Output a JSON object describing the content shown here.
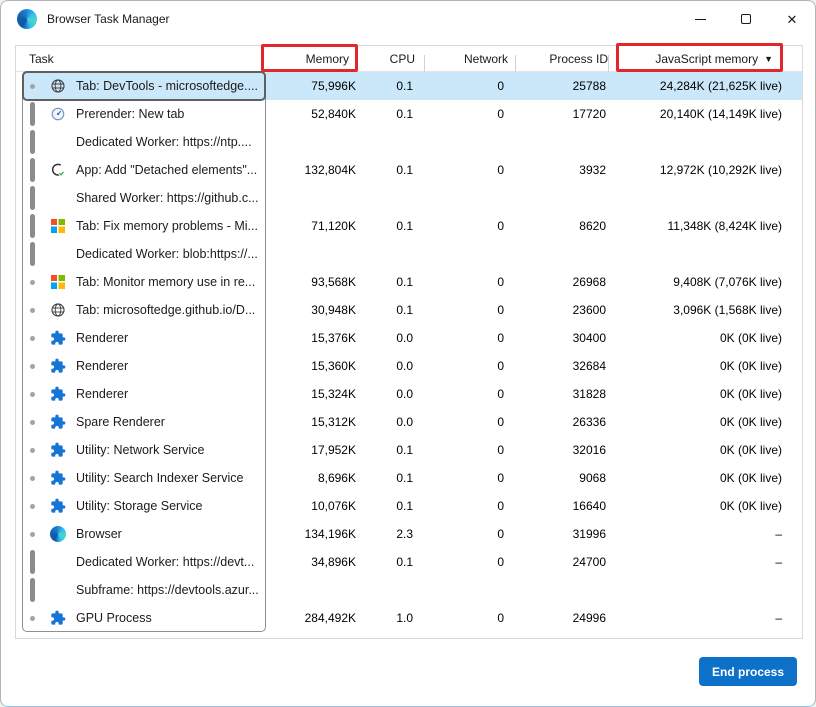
{
  "window": {
    "title": "Browser Task Manager",
    "app_icon": "edge-logo",
    "controls": {
      "minimize": "minimize",
      "maximize": "maximize",
      "close": "close"
    }
  },
  "table": {
    "headers": {
      "task": "Task",
      "memory": "Memory",
      "cpu": "CPU",
      "network": "Network",
      "process_id": "Process ID",
      "js_memory": "JavaScript memory",
      "sort_indicator": "▼",
      "sorted_column": "js_memory"
    },
    "rows": [
      {
        "task": "Tab: DevTools - microsoftedge....",
        "icon": "globe",
        "indicator": "dot",
        "memory": "75,996K",
        "cpu": "0.1",
        "network": "0",
        "pid": "25788",
        "js": "24,284K (21,625K live)",
        "selected": true
      },
      {
        "task": "Prerender: New tab",
        "icon": "newtab",
        "indicator": "bar",
        "memory": "52,840K",
        "cpu": "0.1",
        "network": "0",
        "pid": "17720",
        "js": "20,140K (14,149K live)"
      },
      {
        "task": "Dedicated Worker: https://ntp....",
        "icon": null,
        "indicator": "bar",
        "memory": "",
        "cpu": "",
        "network": "",
        "pid": "",
        "js": ""
      },
      {
        "task": "App: Add \"Detached elements\"...",
        "icon": "app",
        "indicator": "bar",
        "memory": "132,804K",
        "cpu": "0.1",
        "network": "0",
        "pid": "3932",
        "js": "12,972K (10,292K live)"
      },
      {
        "task": "Shared Worker: https://github.c...",
        "icon": null,
        "indicator": "bar",
        "memory": "",
        "cpu": "",
        "network": "",
        "pid": "",
        "js": ""
      },
      {
        "task": "Tab: Fix memory problems - Mi...",
        "icon": "microsoft",
        "indicator": "bar",
        "memory": "71,120K",
        "cpu": "0.1",
        "network": "0",
        "pid": "8620",
        "js": "11,348K (8,424K live)"
      },
      {
        "task": "Dedicated Worker: blob:https://...",
        "icon": null,
        "indicator": "bar",
        "memory": "",
        "cpu": "",
        "network": "",
        "pid": "",
        "js": ""
      },
      {
        "task": "Tab: Monitor memory use in re...",
        "icon": "microsoft",
        "indicator": "dot",
        "memory": "93,568K",
        "cpu": "0.1",
        "network": "0",
        "pid": "26968",
        "js": "9,408K (7,076K live)"
      },
      {
        "task": "Tab: microsoftedge.github.io/D...",
        "icon": "globe",
        "indicator": "dot",
        "memory": "30,948K",
        "cpu": "0.1",
        "network": "0",
        "pid": "23600",
        "js": "3,096K (1,568K live)"
      },
      {
        "task": "Renderer",
        "icon": "puzzle",
        "indicator": "dot",
        "memory": "15,376K",
        "cpu": "0.0",
        "network": "0",
        "pid": "30400",
        "js": "0K (0K live)"
      },
      {
        "task": "Renderer",
        "icon": "puzzle",
        "indicator": "dot",
        "memory": "15,360K",
        "cpu": "0.0",
        "network": "0",
        "pid": "32684",
        "js": "0K (0K live)"
      },
      {
        "task": "Renderer",
        "icon": "puzzle",
        "indicator": "dot",
        "memory": "15,324K",
        "cpu": "0.0",
        "network": "0",
        "pid": "31828",
        "js": "0K (0K live)"
      },
      {
        "task": "Spare Renderer",
        "icon": "puzzle",
        "indicator": "dot",
        "memory": "15,312K",
        "cpu": "0.0",
        "network": "0",
        "pid": "26336",
        "js": "0K (0K live)"
      },
      {
        "task": "Utility: Network Service",
        "icon": "puzzle",
        "indicator": "dot",
        "memory": "17,952K",
        "cpu": "0.1",
        "network": "0",
        "pid": "32016",
        "js": "0K (0K live)"
      },
      {
        "task": "Utility: Search Indexer Service",
        "icon": "puzzle",
        "indicator": "dot",
        "memory": "8,696K",
        "cpu": "0.1",
        "network": "0",
        "pid": "9068",
        "js": "0K (0K live)"
      },
      {
        "task": "Utility: Storage Service",
        "icon": "puzzle",
        "indicator": "dot",
        "memory": "10,076K",
        "cpu": "0.1",
        "network": "0",
        "pid": "16640",
        "js": "0K (0K live)"
      },
      {
        "task": "Browser",
        "icon": "edge",
        "indicator": "dot",
        "memory": "134,196K",
        "cpu": "2.3",
        "network": "0",
        "pid": "31996",
        "js": "–"
      },
      {
        "task": "Dedicated Worker: https://devt...",
        "icon": null,
        "indicator": "bar",
        "memory": "34,896K",
        "cpu": "0.1",
        "network": "0",
        "pid": "24700",
        "js": "–"
      },
      {
        "task": "Subframe: https://devtools.azur...",
        "icon": null,
        "indicator": "bar",
        "memory": "",
        "cpu": "",
        "network": "",
        "pid": "",
        "js": ""
      },
      {
        "task": "GPU Process",
        "icon": "puzzle",
        "indicator": "dot",
        "memory": "284,492K",
        "cpu": "1.0",
        "network": "0",
        "pid": "24996",
        "js": "–"
      }
    ]
  },
  "annotations": {
    "highlight_color": "#e1262d",
    "highlighted_headers": [
      "Memory",
      "JavaScript memory"
    ]
  },
  "footer": {
    "end_process_label": "End process"
  },
  "colors": {
    "selected_row": "#cbe8fa",
    "primary_button": "#0d70c9",
    "microsoft_logo": [
      "#f25022",
      "#7fba00",
      "#00a4ef",
      "#ffb900"
    ]
  }
}
